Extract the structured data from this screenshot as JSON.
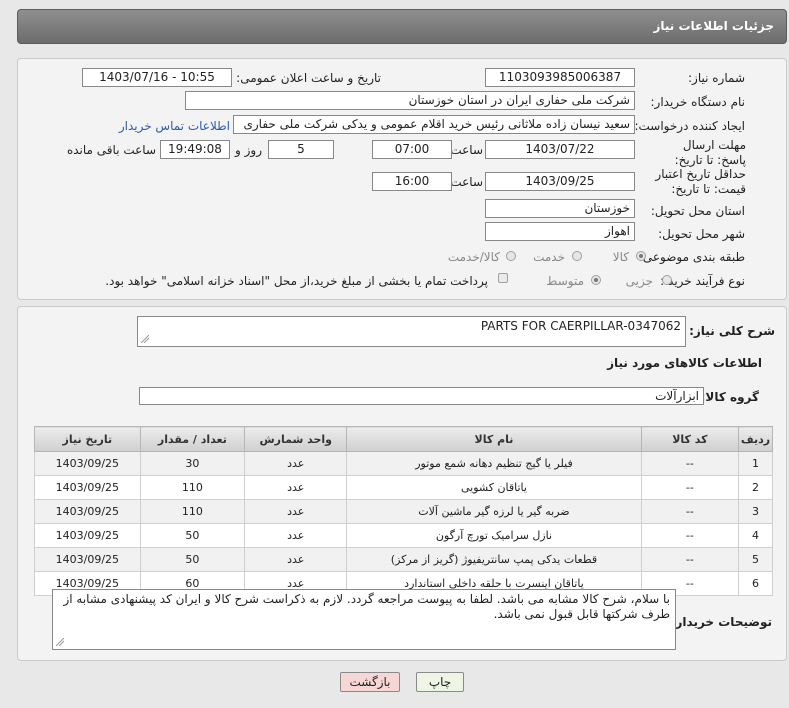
{
  "page": {
    "title": "جزئیات اطلاعات نیاز"
  },
  "need_info": {
    "need_number_label": "شماره نیاز:",
    "need_number": "1103093985006387",
    "announce_label": "تاریخ و ساعت اعلان عمومی:",
    "announce_value": "1403/07/16 - 10:55",
    "buyer_org_label": "نام دستگاه خریدار:",
    "buyer_org": "شرکت ملی حفاری ایران در استان خوزستان",
    "creator_label": "ایجاد کننده درخواست:",
    "creator": "سعید نیسان زاده ملاثانی رئیس خرید اقلام عمومی و یدکی شرکت ملی حفاری",
    "contact_link": "اطلاعات تماس خریدار",
    "deadline_label": "مهلت ارسال پاسخ: تا تاریخ:",
    "deadline_date": "1403/07/22",
    "time_label": "ساعت",
    "deadline_time": "07:00",
    "days_value": "5",
    "days_label": "روز و",
    "remaining_time": "19:49:08",
    "remaining_label": "ساعت باقی مانده",
    "validity_label": "حداقل تاریخ اعتبار قیمت: تا تاریخ:",
    "validity_date": "1403/09/25",
    "validity_time": "16:00",
    "province_label": "استان محل تحویل:",
    "province": "خوزستان",
    "city_label": "شهر محل تحویل:",
    "city": "اهواز",
    "category_label": "طبقه بندی موضوعی:",
    "category_options": [
      "کالا",
      "خدمت",
      "کالا/خدمت"
    ],
    "process_label": "نوع فرآیند خرید :",
    "process_options": [
      "جزیی",
      "متوسط"
    ],
    "payment_note": "پرداخت تمام یا بخشی از مبلغ خرید،از محل \"اسناد خزانه اسلامی\" خواهد بود."
  },
  "details": {
    "summary_label": "شرح کلی نیاز:",
    "summary": "PARTS FOR CAERPILLAR-0347062",
    "goods_info_title": "اطلاعات کالاهای مورد نیاز",
    "group_label": "گروه کالا:",
    "group_value": "ابزارآلات",
    "columns": [
      "ردیف",
      "کد کالا",
      "نام کالا",
      "واحد شمارش",
      "تعداد / مقدار",
      "تاریخ نیاز"
    ],
    "rows": [
      [
        "1",
        "--",
        "فیلر یا گیج تنظیم دهانه شمع موتور",
        "عدد",
        "30",
        "1403/09/25"
      ],
      [
        "2",
        "--",
        "یاتاقان کشویی",
        "عدد",
        "110",
        "1403/09/25"
      ],
      [
        "3",
        "--",
        "ضربه گیر یا لرزه گیر ماشین آلات",
        "عدد",
        "110",
        "1403/09/25"
      ],
      [
        "4",
        "--",
        "نازل سرامیک تورچ آرگون",
        "عدد",
        "50",
        "1403/09/25"
      ],
      [
        "5",
        "--",
        "قطعات یدکی پمپ سانتریفیوژ (گریز از مرکز)",
        "عدد",
        "50",
        "1403/09/25"
      ],
      [
        "6",
        "--",
        "یاتاقان اینسرت با حلقه داخلی استاندارد",
        "عدد",
        "60",
        "1403/09/25"
      ]
    ],
    "buyer_notes_label": "توضیحات خریدار:",
    "buyer_notes": "با سلام، شرح کالا مشابه می باشد. لطفا به پیوست مراجعه گردد. لازم به ذکراست شرح کالا و ایران کد  پیشنهادی مشابه از طرف شرکتها قابل قبول نمی باشد."
  },
  "buttons": {
    "print": "چاپ",
    "back": "بازگشت"
  },
  "colors": {
    "header": "#7a7a7a",
    "back_button": "#f7d6d6",
    "print_button": "#eef5e4"
  }
}
